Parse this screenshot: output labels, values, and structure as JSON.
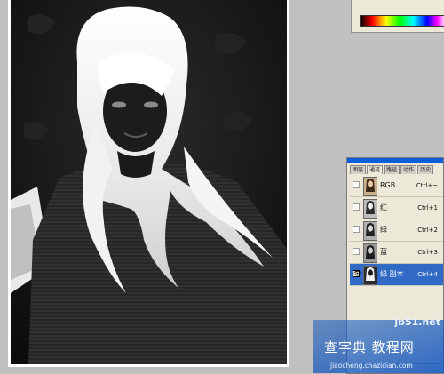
{
  "panel_tabs": [
    "图层",
    "通道",
    "路径",
    "动作",
    "历史"
  ],
  "channels": [
    {
      "name": "RGB",
      "shortcut": "Ctrl+~",
      "selected": false
    },
    {
      "name": "红",
      "shortcut": "Ctrl+1",
      "selected": false
    },
    {
      "name": "绿",
      "shortcut": "Ctrl+2",
      "selected": false
    },
    {
      "name": "蓝",
      "shortcut": "Ctrl+3",
      "selected": false
    },
    {
      "name": "绿 副本",
      "shortcut": "Ctrl+4",
      "selected": true
    }
  ],
  "watermark": {
    "domain": "jb51.net",
    "chinese": "查字典 教程网",
    "url": "jiaocheng.chazidian.com"
  },
  "colors": {
    "selection": "#316ac5",
    "panel_bg": "#ece9d8",
    "workspace": "#c0c0c0"
  }
}
